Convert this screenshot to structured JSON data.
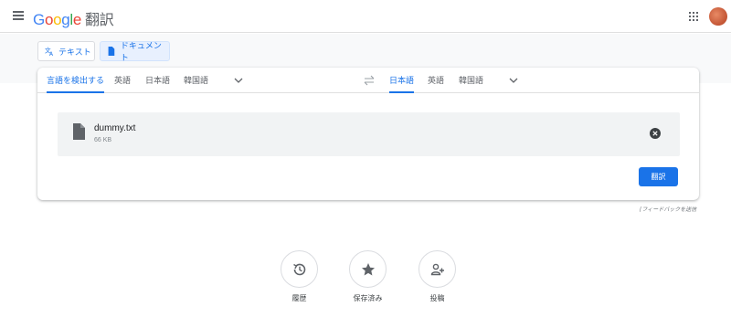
{
  "header": {
    "logo_parts": [
      "G",
      "o",
      "o",
      "g",
      "l",
      "e"
    ],
    "product_name": "翻訳",
    "menu_icon": "hamburger-menu-icon",
    "apps_icon": "apps-grid-icon"
  },
  "modes": [
    {
      "label": "テキスト",
      "icon": "translate-icon",
      "active": false
    },
    {
      "label": "ドキュメント",
      "icon": "document-icon",
      "active": true
    }
  ],
  "source_langs": [
    {
      "label": "言語を検出する",
      "active": true
    },
    {
      "label": "英語",
      "active": false
    },
    {
      "label": "日本語",
      "active": false
    },
    {
      "label": "韓国語",
      "active": false
    }
  ],
  "target_langs": [
    {
      "label": "日本語",
      "active": true
    },
    {
      "label": "英語",
      "active": false
    },
    {
      "label": "韓国語",
      "active": false
    }
  ],
  "file": {
    "name": "dummy.txt",
    "size": "66 KB"
  },
  "translate_button": "翻訳",
  "feedback_link": "フィードバックを送信",
  "actions": [
    {
      "label": "履歴",
      "icon": "history-icon"
    },
    {
      "label": "保存済み",
      "icon": "star-icon"
    },
    {
      "label": "投稿",
      "icon": "contribute-icon"
    }
  ],
  "colors": {
    "accent": "#1a73e8",
    "panel_bg": "#f1f3f4",
    "band_bg": "#f8f9fa"
  }
}
